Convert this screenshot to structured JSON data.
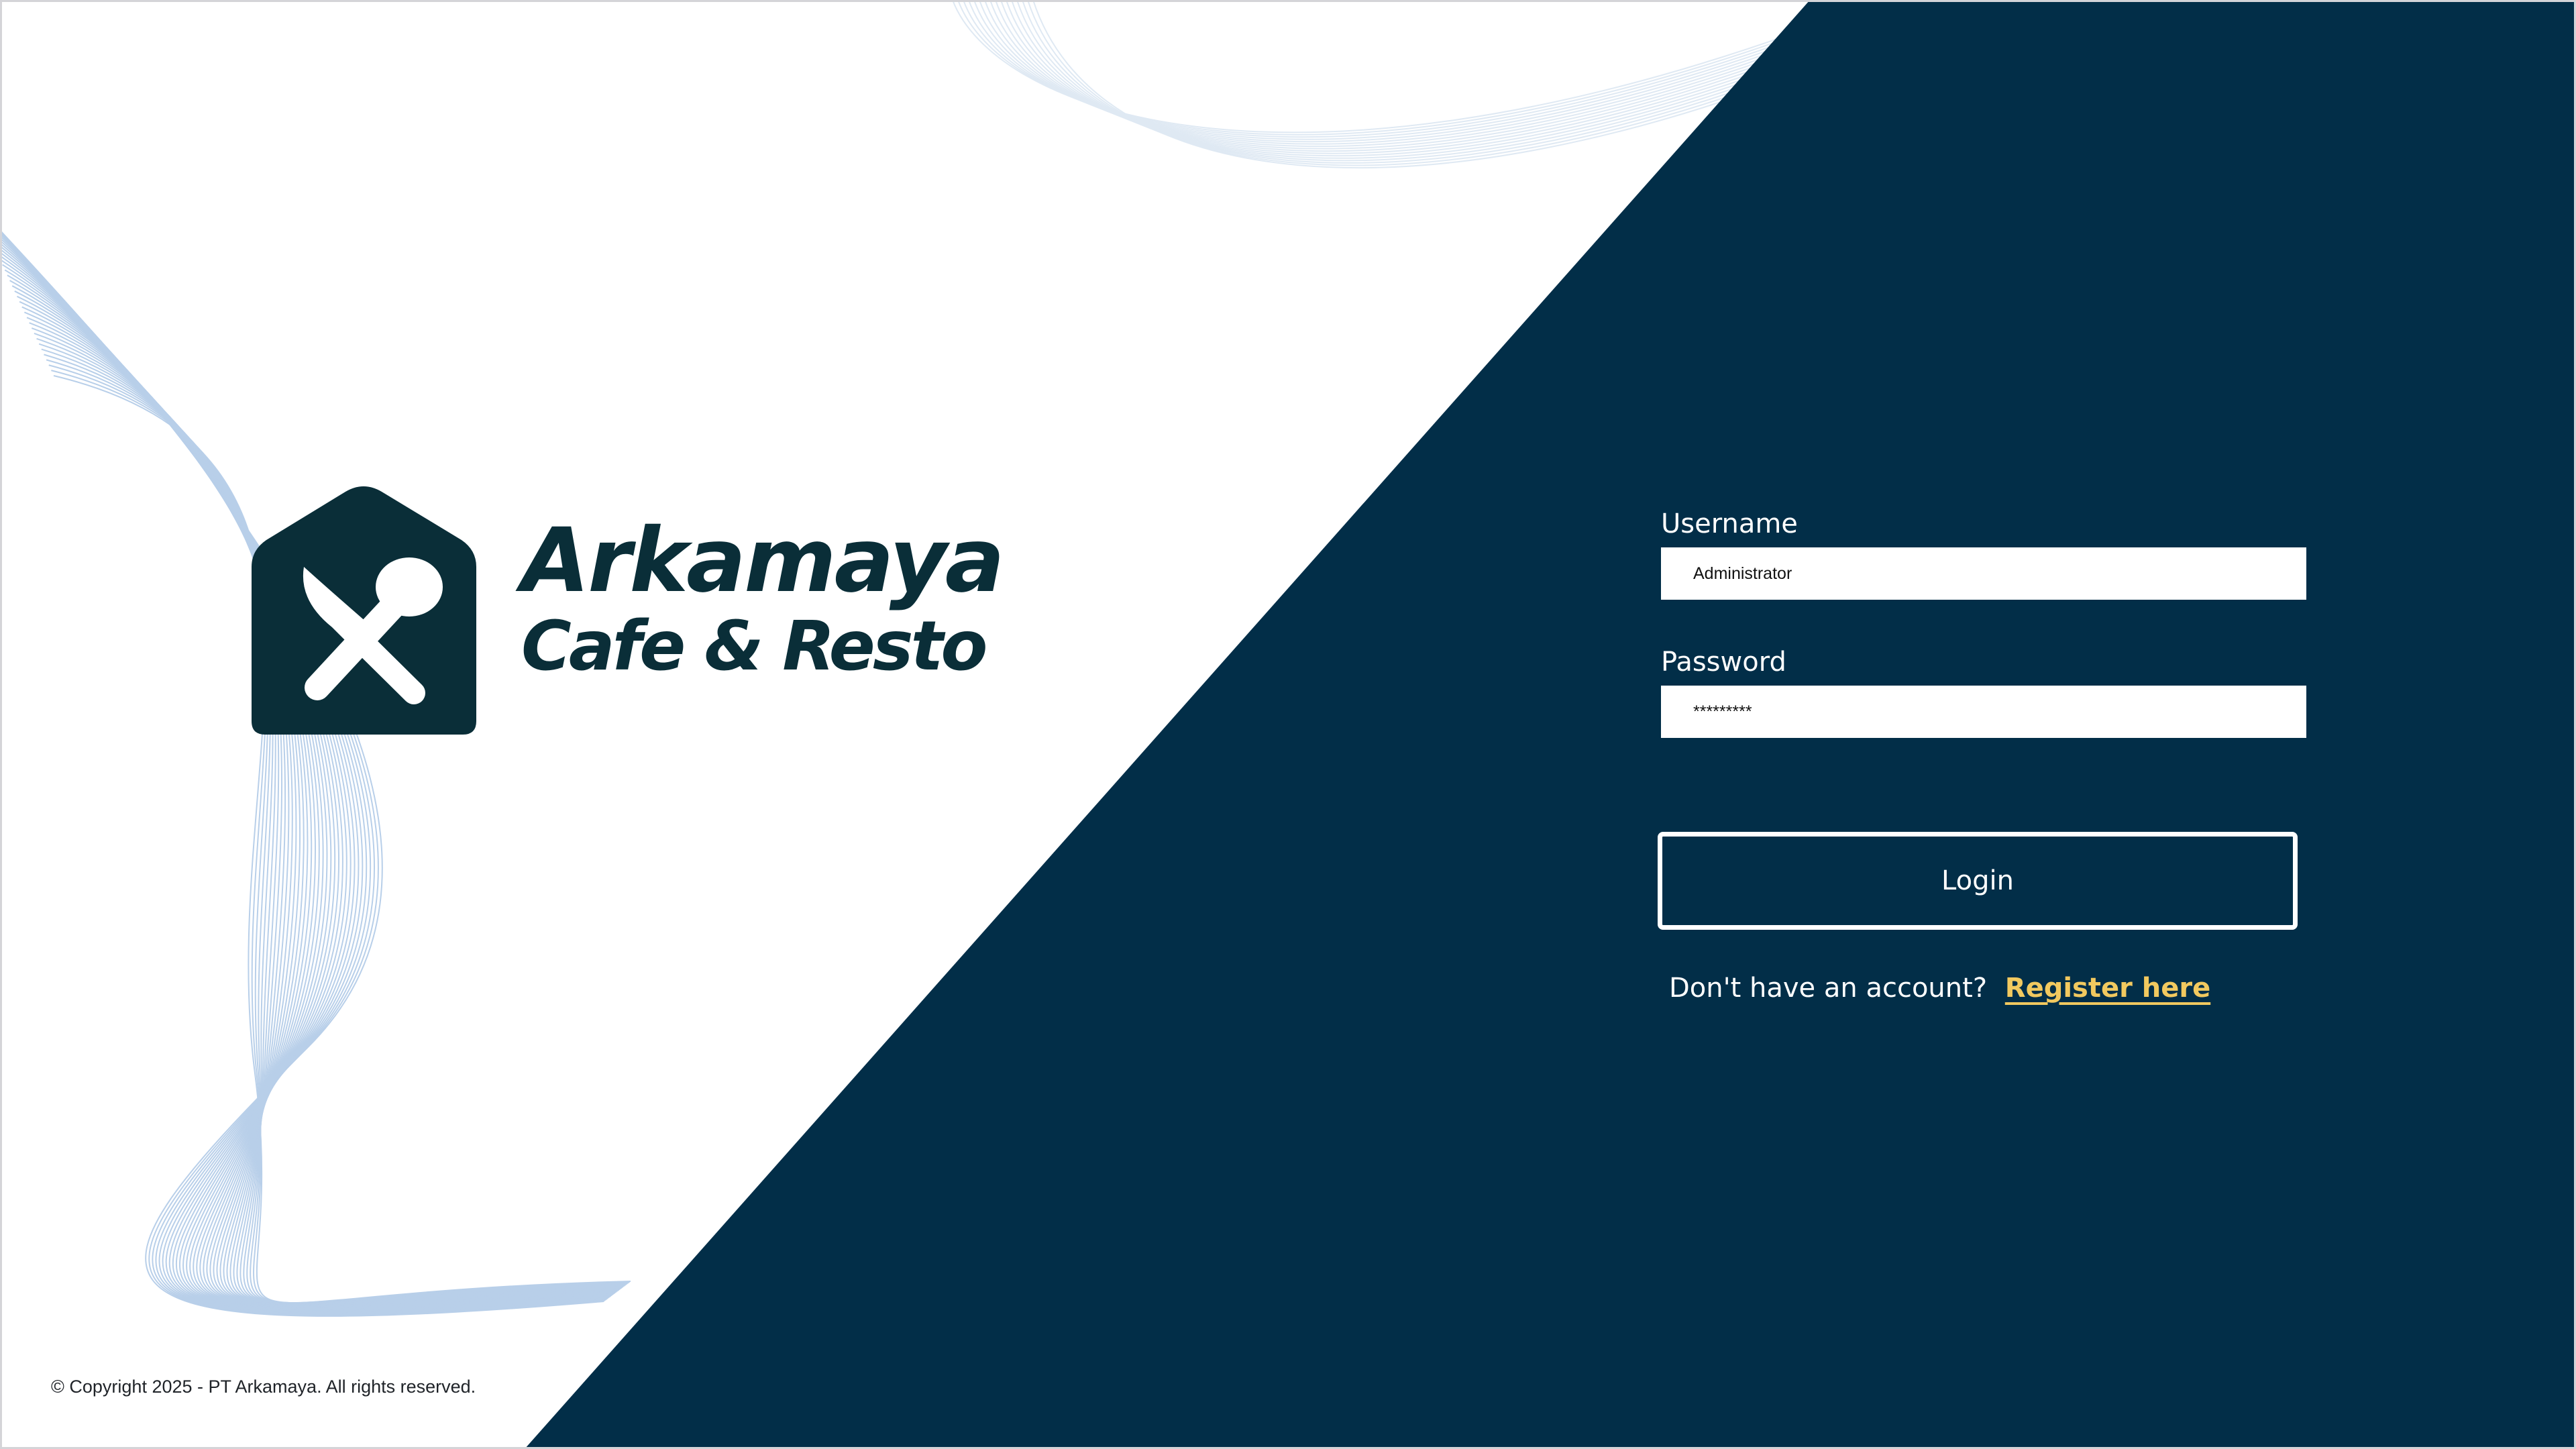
{
  "brand": {
    "name_line1": "Arkamaya",
    "name_line2": "Cafe & Resto",
    "logo_icon": "house-fork-spoon-icon"
  },
  "footer": {
    "copyright": "© Copyright 2025 - PT Arkamaya. All rights reserved."
  },
  "login_form": {
    "username_label": "Username",
    "username_value": "Administrator",
    "password_label": "Password",
    "password_value": "*********",
    "login_button": "Login",
    "register_prompt": "Don't have an account?",
    "register_link": "Register here"
  },
  "colors": {
    "panel_navy": "#022e48",
    "brand_dark": "#0a2e38",
    "link_yellow": "#f2c95f",
    "wave_blue": "#7fa8d8"
  }
}
